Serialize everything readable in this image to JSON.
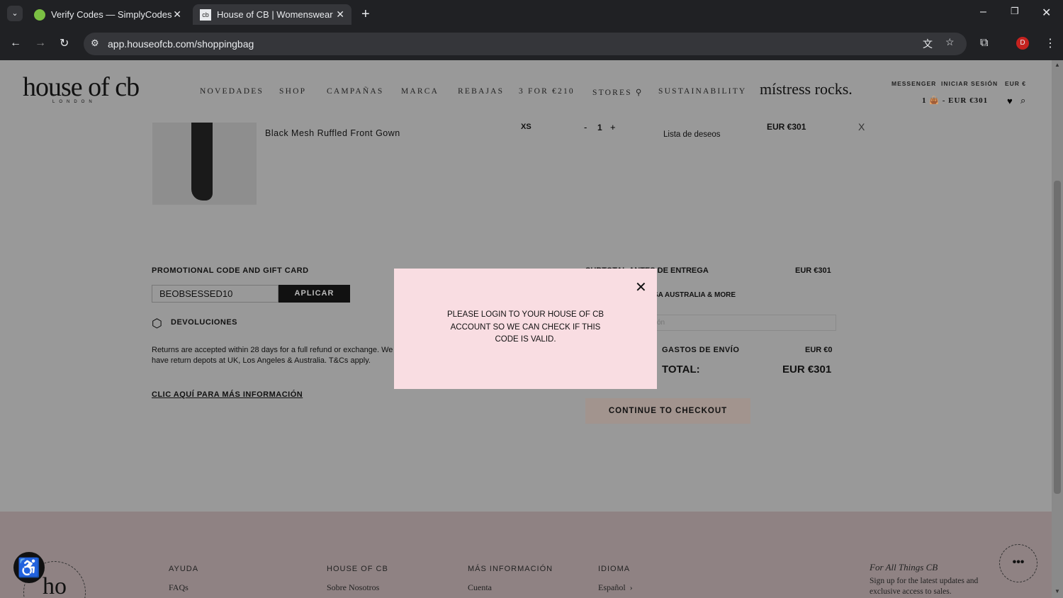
{
  "browser": {
    "tabs": [
      {
        "title": "Verify Codes — SimplyCodes"
      },
      {
        "title": "House of CB | Womenswear de"
      }
    ],
    "url": "app.houseofcb.com/shoppingbag",
    "profile_initial": "D"
  },
  "header": {
    "logo": "house of cb",
    "logo_sub": "LONDON",
    "nav": [
      "NOVEDADES",
      "SHOP",
      "CAMPAÑAS",
      "MARCA",
      "REBAJAS",
      "3 FOR €210",
      "STORES",
      "SUSTAINABILITY"
    ],
    "campaign": "místress rocks.",
    "top_links": [
      "MESSENGER",
      "INICIAR SESIÓN",
      "EUR €"
    ],
    "bag_count": "1",
    "bag_total": "- EUR €301"
  },
  "item": {
    "name": "Black Mesh Ruffled Front Gown",
    "size": "XS",
    "qty": "1",
    "minus": "-",
    "plus": "+",
    "wishlist": "Lista de deseos",
    "price": "EUR €301",
    "remove": "X"
  },
  "promo": {
    "title": "PROMOTIONAL CODE AND GIFT CARD",
    "code": "BEOBSESSED10",
    "apply": "APLICAR"
  },
  "returns": {
    "title": "DEVOLUCIONES",
    "text": "Returns are accepted within 28 days for a full refund or exchange. We have return depots at UK, Los Angeles & Australia. T&Cs apply.",
    "link": "CLIC AQUÍ PARA MÁS INFORMACIÓN"
  },
  "summary": {
    "subtotal_label": "SUBTOTAL ANTES DE ENTREGA",
    "subtotal": "EUR €301",
    "delivery": "DELIVERY TO UK, USA AUSTRALIA & MORE",
    "location_placeholder": "ón",
    "shipping_label": "GASTOS DE ENVÍO",
    "shipping": "EUR €0",
    "total_label": "TOTAL:",
    "total": "EUR €301",
    "checkout": "CONTINUE TO CHECKOUT"
  },
  "modal": {
    "message": "PLEASE LOGIN TO YOUR HOUSE OF CB ACCOUNT SO WE CAN CHECK IF THIS CODE IS VALID."
  },
  "footer": {
    "cols": [
      {
        "title": "AYUDA",
        "link": "FAQs"
      },
      {
        "title": "HOUSE OF CB",
        "link": "Sobre Nosotros"
      },
      {
        "title": "MÁS INFORMACIÓN",
        "link": "Cuenta"
      },
      {
        "title": "IDIOMA",
        "link": "Español"
      }
    ],
    "news_title": "For All Things CB",
    "news_text": "Sign up for the latest updates and exclusive access to sales.",
    "badge_text": "ho"
  }
}
